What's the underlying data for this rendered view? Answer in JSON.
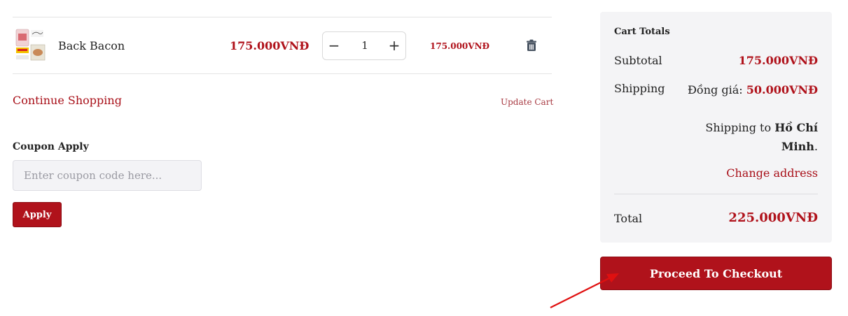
{
  "cart": {
    "item": {
      "name": "Back Bacon",
      "unit_price": "175.000VNĐ",
      "quantity": "1",
      "line_total": "175.000VNĐ",
      "thumbnail_icon": "product-thumbnail",
      "decrement_icon": "minus",
      "increment_icon": "plus",
      "remove_icon": "trash-icon"
    },
    "continue_label": "Continue Shopping",
    "update_label": "Update Cart"
  },
  "coupon": {
    "title": "Coupon Apply",
    "placeholder": "Enter coupon code here...",
    "apply_label": "Apply"
  },
  "totals": {
    "title": "Cart Totals",
    "subtotal_label": "Subtotal",
    "subtotal_value": "175.000VNĐ",
    "shipping_label": "Shipping",
    "shipping_method": "Đồng giá: ",
    "shipping_value": "50.000VNĐ",
    "shipping_to_prefix": "Shipping to ",
    "shipping_to_city": "Hồ Chí Minh",
    "shipping_to_suffix": ".",
    "change_address_label": "Change address",
    "total_label": "Total",
    "total_value": "225.000VNĐ"
  },
  "checkout": {
    "label": "Proceed To Checkout"
  },
  "colors": {
    "accent": "#b0121b",
    "panel_bg": "#f4f4f6",
    "annotation_arrow": "#e01010"
  }
}
